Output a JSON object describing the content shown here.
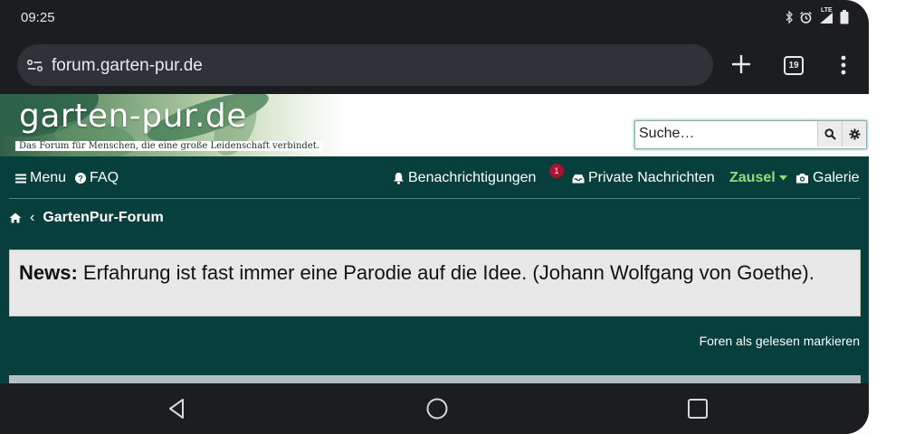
{
  "status_bar": {
    "time": "09:25",
    "network_label": "LTE",
    "icons": [
      "bluetooth-icon",
      "alarm-icon",
      "signal-icon",
      "battery-icon"
    ]
  },
  "browser": {
    "url": "forum.garten-pur.de",
    "tab_count": "19",
    "icons": [
      "site-info-icon",
      "new-tab-icon",
      "tab-switcher-icon",
      "more-menu-icon"
    ]
  },
  "site": {
    "logo_text": "garten-pur.de",
    "tagline": "Das Forum für Menschen, die eine große Leidenschaft verbindet.",
    "search_placeholder": "Suche…"
  },
  "nav": {
    "menu_label": "Menu",
    "faq_label": "FAQ",
    "notifications_label": "Benachrichtigungen",
    "notifications_count": "1",
    "messages_label": "Private Nachrichten",
    "user_label": "Zausel",
    "gallery_label": "Galerie"
  },
  "breadcrumb": {
    "separator": "‹",
    "current": "GartenPur-Forum"
  },
  "news": {
    "label": "News:",
    "text": " Erfahrung ist fast immer eine Parodie auf die Idee. (Johann Wolfgang von Goethe)."
  },
  "actions": {
    "mark_read": "Foren als gelesen markieren"
  },
  "colors": {
    "page_background": "#063f3b",
    "user_accent": "#8fe07a",
    "badge": "#aa1133",
    "news_background": "#e8e8e8"
  }
}
